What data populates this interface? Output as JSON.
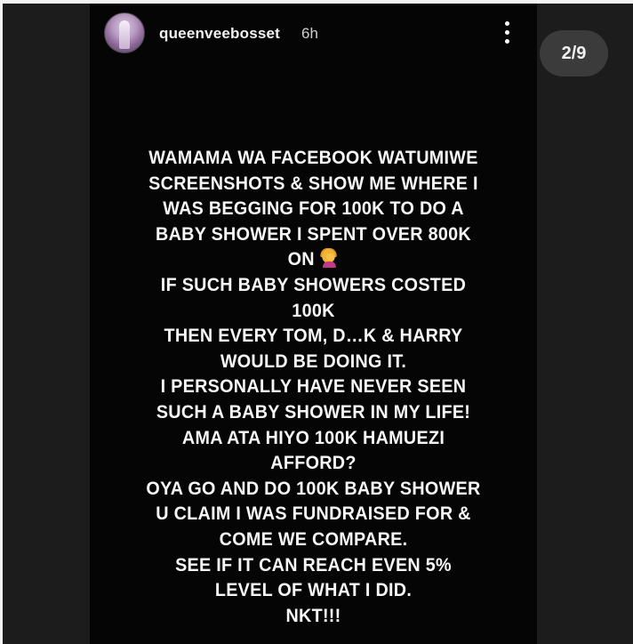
{
  "story": {
    "username": "queenveebosset",
    "time_ago": "6h",
    "counter": "2/9"
  },
  "icons": {
    "avatar": "profile-picture",
    "more": "more-vertical-icon",
    "emoji": "face-palm-woman-emoji"
  },
  "message": {
    "lines": [
      "WAMAMA WA FACEBOOK WATUMIWE",
      "SCREENSHOTS & SHOW ME WHERE I",
      "WAS BEGGING FOR 100K TO DO A",
      "BABY SHOWER I SPENT OVER 800K",
      "ON",
      "IF SUCH BABY SHOWERS COSTED",
      "100K",
      "THEN  EVERY TOM, D…K & HARRY",
      "WOULD BE DOING IT.",
      "I PERSONALLY HAVE NEVER SEEN",
      "SUCH A BABY SHOWER IN MY LIFE!",
      "AMA ATA HIYO 100K HAMUEZI",
      "AFFORD?",
      "OYA GO AND DO 100K BABY SHOWER",
      "U CLAIM I WAS FUNDRAISED FOR &",
      "COME WE COMPARE.",
      "SEE IF IT CAN REACH EVEN 5%",
      "LEVEL OF WHAT I DID.",
      "NKT!!!"
    ]
  },
  "colors": {
    "story_background": "#050505",
    "side_background": "#1c1c1c",
    "text": "#f6f6f6",
    "counter_pill": "#3b3b3b"
  }
}
